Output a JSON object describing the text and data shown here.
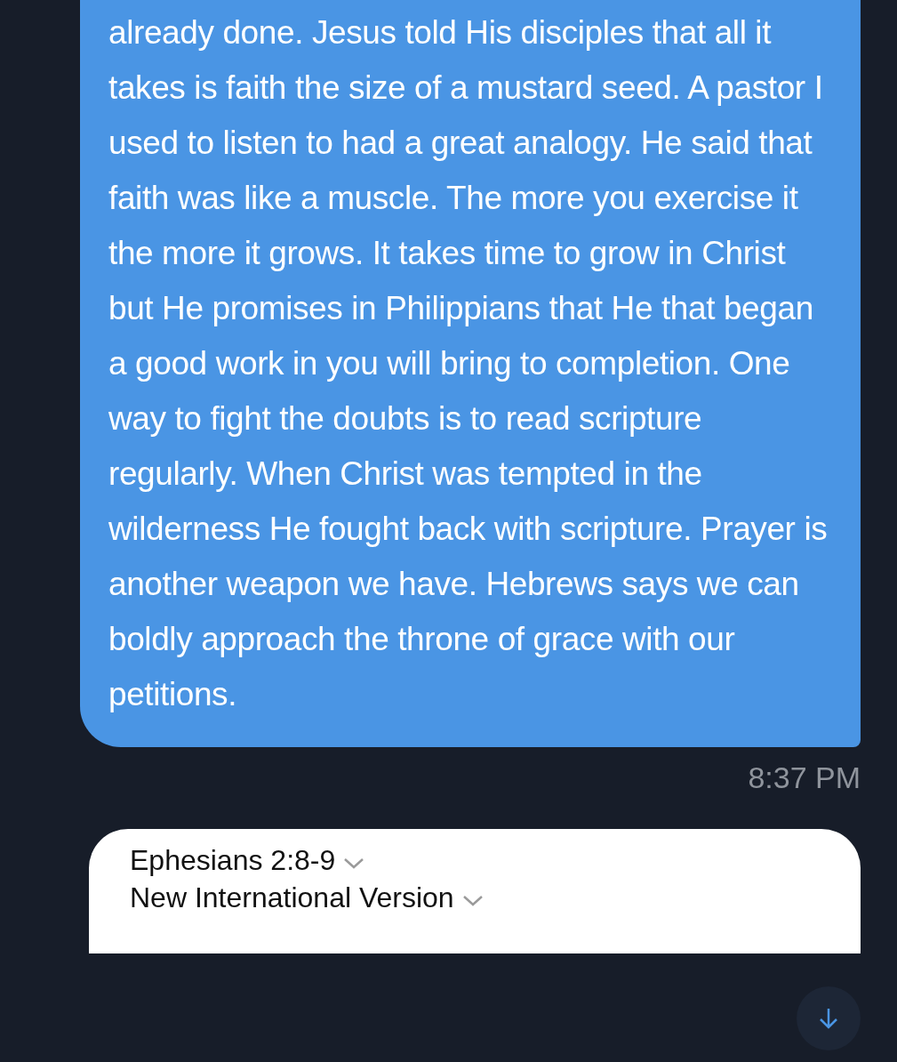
{
  "message": {
    "text": "already done. Jesus told His disciples that all it takes is faith the size of a mustard seed. A pastor I used to listen to had a great analogy. He said that faith was like a muscle. The more you exercise it the more it grows. It takes time to grow in Christ but He promises in Philippians that He that began a good work in you will bring to completion. One way to fight the doubts is to read scripture regularly. When Christ was tempted in the wilderness He fought back with scripture. Prayer is another weapon we have. Hebrews says we can boldly approach the throne of grace with our petitions.",
    "time": "8:37 PM"
  },
  "link_card": {
    "reference": "Ephesians 2:8-9",
    "version": "New International Version"
  }
}
